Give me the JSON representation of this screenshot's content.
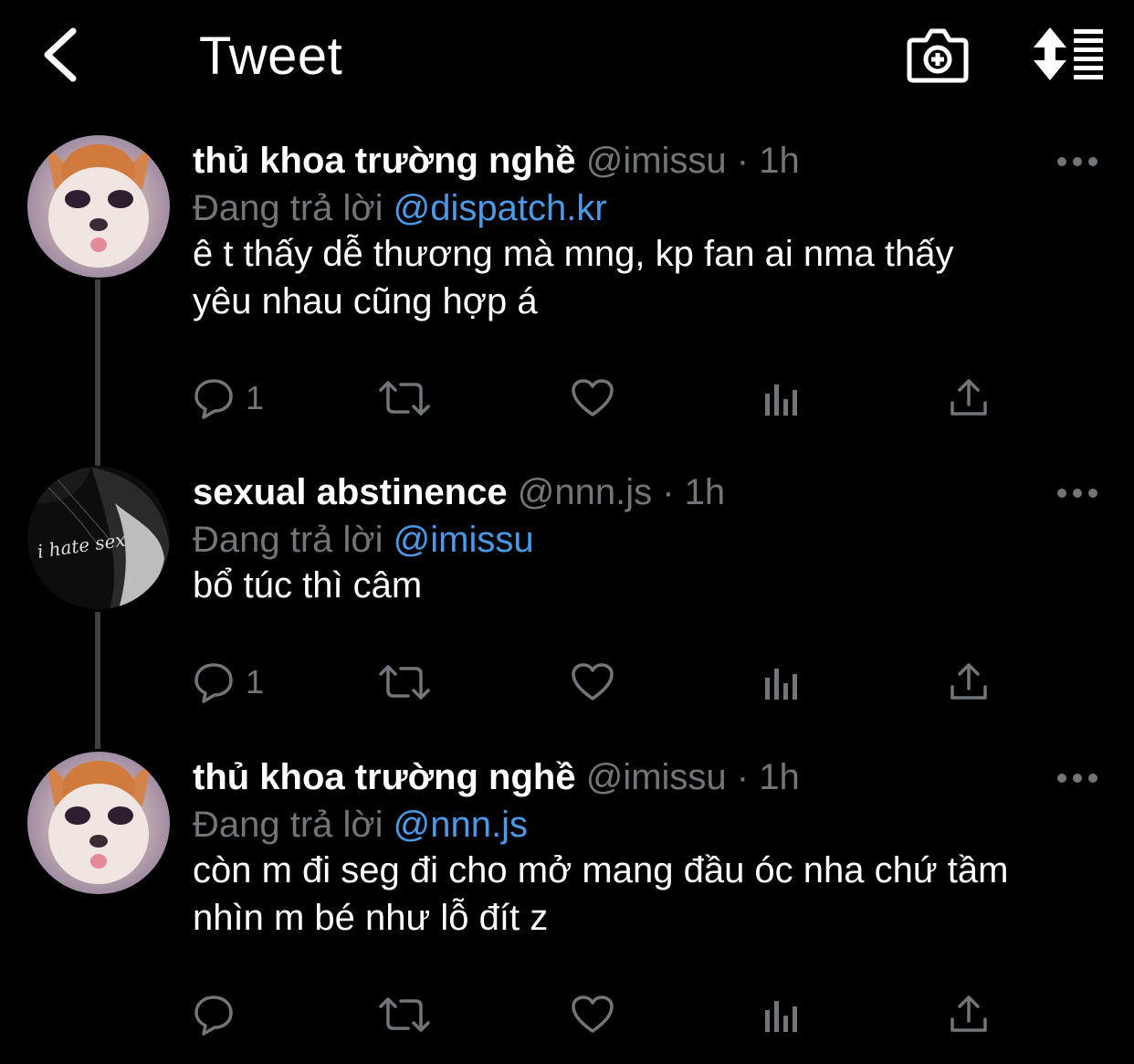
{
  "header": {
    "title": "Tweet",
    "back_icon": "chevron-left-icon",
    "camera_icon": "camera-plus-icon",
    "sort_icon": "sort-list-icon"
  },
  "colors": {
    "background": "#000000",
    "name": "#ffffff",
    "meta": "#71767b",
    "mention": "#4a9ae8",
    "thread_line": "#3e4144"
  },
  "tweets": [
    {
      "name": "thủ khoa trường nghề",
      "handle": "@imissu",
      "sep": "·",
      "time": "1h",
      "reply_prefix": "Đang trả lời",
      "reply_to": "@dispatch.kr",
      "text_lines": [
        "ê t thấy dễ thương mà mng, kp fan ai nma thấy",
        "yêu nhau cũng hợp á"
      ],
      "reply_count": "1",
      "avatar": "cat-avatar"
    },
    {
      "name": "sexual abstinence",
      "handle": "@nnn.js",
      "sep": "·",
      "time": "1h",
      "reply_prefix": "Đang trả lời",
      "reply_to": "@imissu",
      "text_lines": [
        "bổ túc thì câm"
      ],
      "reply_count": "1",
      "avatar": "dark-photo-avatar",
      "avatar_caption": "i hate sex"
    },
    {
      "name": "thủ khoa trường nghề",
      "handle": "@imissu",
      "sep": "·",
      "time": "1h",
      "reply_prefix": "Đang trả lời",
      "reply_to": "@nnn.js",
      "text_lines": [
        "còn m đi seg đi cho mở mang đầu óc nha chứ tầm",
        "nhìn m bé như lỗ đít z"
      ],
      "reply_count": "",
      "avatar": "cat-avatar"
    }
  ]
}
